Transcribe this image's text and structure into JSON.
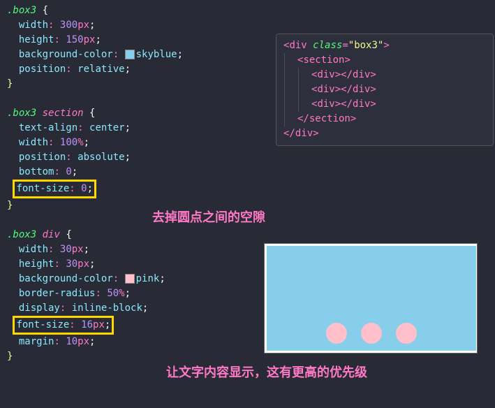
{
  "css": {
    "rule1": {
      "selector": ".box3",
      "p1": {
        "k": "width",
        "v": "300",
        "u": "px"
      },
      "p2": {
        "k": "height",
        "v": "150",
        "u": "px"
      },
      "p3": {
        "k": "background-color",
        "v": "skyblue",
        "swatch": "#87ceeb"
      },
      "p4": {
        "k": "position",
        "v": "relative"
      }
    },
    "rule2": {
      "selector": ".box3",
      "selector_tag": "section",
      "p1": {
        "k": "text-align",
        "v": "center"
      },
      "p2": {
        "k": "width",
        "v": "100",
        "u": "%"
      },
      "p3": {
        "k": "position",
        "v": "absolute"
      },
      "p4": {
        "k": "bottom",
        "v": "0"
      },
      "p5": {
        "k": "font-size",
        "v": "0"
      }
    },
    "rule3": {
      "selector": ".box3",
      "selector_tag": "div",
      "p1": {
        "k": "width",
        "v": "30",
        "u": "px"
      },
      "p2": {
        "k": "height",
        "v": "30",
        "u": "px"
      },
      "p3": {
        "k": "background-color",
        "v": "pink",
        "swatch": "#ffc0cb"
      },
      "p4": {
        "k": "border-radius",
        "v": "50",
        "u": "%"
      },
      "p5": {
        "k": "display",
        "v": "inline-block"
      },
      "p6": {
        "k": "font-size",
        "v": "16",
        "u": "px"
      },
      "p7": {
        "k": "margin",
        "v": "10",
        "u": "px"
      }
    }
  },
  "html": {
    "tag_div": "div",
    "attr_class": "class",
    "val_box3": "\"box3\"",
    "tag_section": "section"
  },
  "annotations": {
    "a1": "去掉圆点之间的空隙",
    "a2": "让文字内容显示，这有更高的优先级"
  }
}
